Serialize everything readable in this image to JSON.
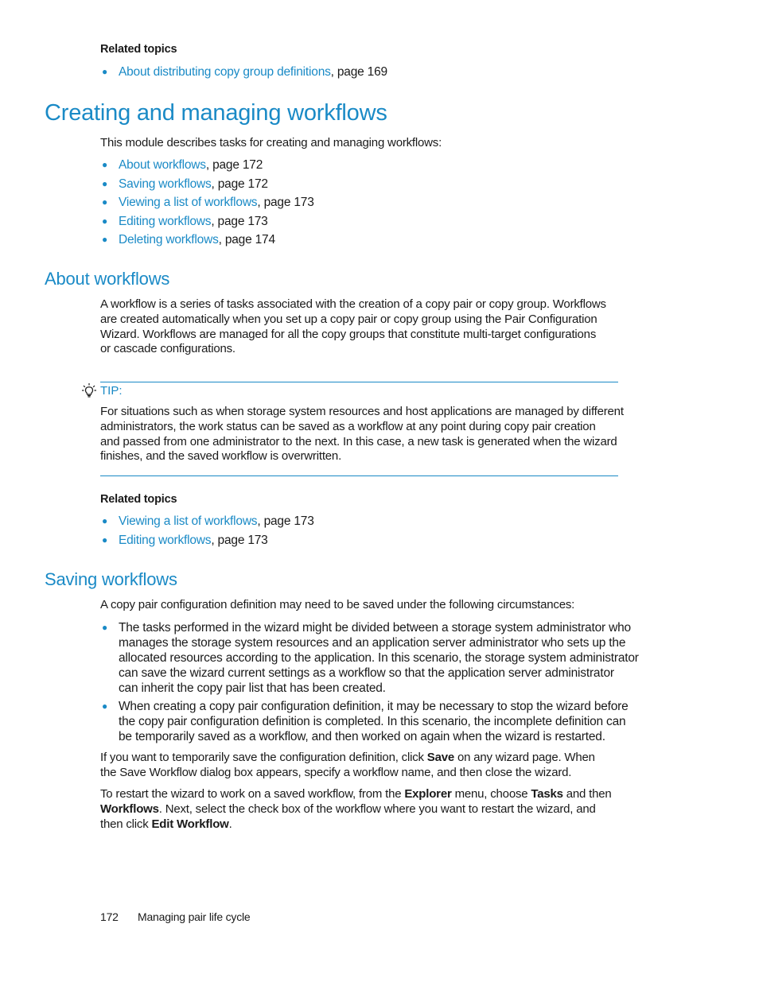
{
  "top_related": {
    "heading": "Related topics",
    "items": [
      {
        "link": "About distributing copy group definitions",
        "suffix": ", page 169"
      }
    ]
  },
  "section_creating": {
    "title": "Creating and managing workflows",
    "intro": "This module describes tasks for creating and managing workflows:",
    "items": [
      {
        "link": "About workflows",
        "suffix": ", page 172"
      },
      {
        "link": "Saving workflows",
        "suffix": ", page 172"
      },
      {
        "link": "Viewing a list of workflows",
        "suffix": ", page 173"
      },
      {
        "link": "Editing workflows",
        "suffix": ", page 173"
      },
      {
        "link": "Deleting workflows",
        "suffix": ", page 174"
      }
    ]
  },
  "section_about": {
    "title": "About workflows",
    "paragraph_lines": [
      "A workflow is a series of tasks associated with the creation of a copy pair or copy group.  Workflows",
      "are created automatically when you set up a copy pair or copy group using the Pair Configuration",
      "Wizard. Workflows are managed for all the copy groups that constitute multi-target configurations",
      "or cascade configurations."
    ],
    "tip": {
      "icon": "lightbulb-icon",
      "label": "TIP:",
      "lines": [
        "For situations such as when storage system resources and host applications are managed by different",
        "administrators, the work status can be saved as a workflow at any point during copy pair creation",
        "and passed from one administrator to the next. In this case, a new task is generated when the wizard",
        "finishes, and the saved workflow is overwritten."
      ]
    },
    "related": {
      "heading": "Related topics",
      "items": [
        {
          "link": "Viewing a list of workflows",
          "suffix": ", page 173"
        },
        {
          "link": "Editing workflows",
          "suffix": ", page 173"
        }
      ]
    }
  },
  "section_saving": {
    "title": "Saving workflows",
    "intro": "A copy pair configuration definition may need to be saved under the following circumstances:",
    "bullets": [
      {
        "lines": [
          "The tasks performed in the wizard might be divided between a storage system administrator who",
          "manages the storage system resources and an application server administrator who sets up the",
          "allocated resources according to the application. In this scenario, the storage system administrator",
          "can save the wizard current settings as a workflow so that the application server administrator",
          "can inherit the copy pair list that has been created."
        ]
      },
      {
        "lines": [
          "When creating a copy pair configuration definition, it may be necessary to stop the wizard before",
          "the copy pair configuration definition is completed. In this scenario, the incomplete definition can",
          "be temporarily saved as a workflow, and then worked on again when the wizard is restarted."
        ]
      }
    ],
    "para1": {
      "l1_a": "If you want to temporarily save the configuration definition, click ",
      "l1_b": "Save",
      "l1_c": " on any wizard page. When",
      "l2": "the Save Workflow dialog box appears, specify a workflow name, and then close the wizard."
    },
    "para2": {
      "l1_a": "To restart the wizard to work on a saved workflow, from the ",
      "l1_b": "Explorer",
      "l1_c": " menu, choose ",
      "l1_d": "Tasks",
      "l1_e": " and then",
      "l2_a": "Workflows",
      "l2_b": ". Next, select the check box of the workflow where you want to restart the wizard, and",
      "l3_a": "then click ",
      "l3_b": "Edit Workflow",
      "l3_c": "."
    }
  },
  "footer": {
    "page_number": "172",
    "chapter": "Managing pair life cycle"
  },
  "colors": {
    "accent": "#1a8ac6",
    "text": "#1a1a1a"
  }
}
